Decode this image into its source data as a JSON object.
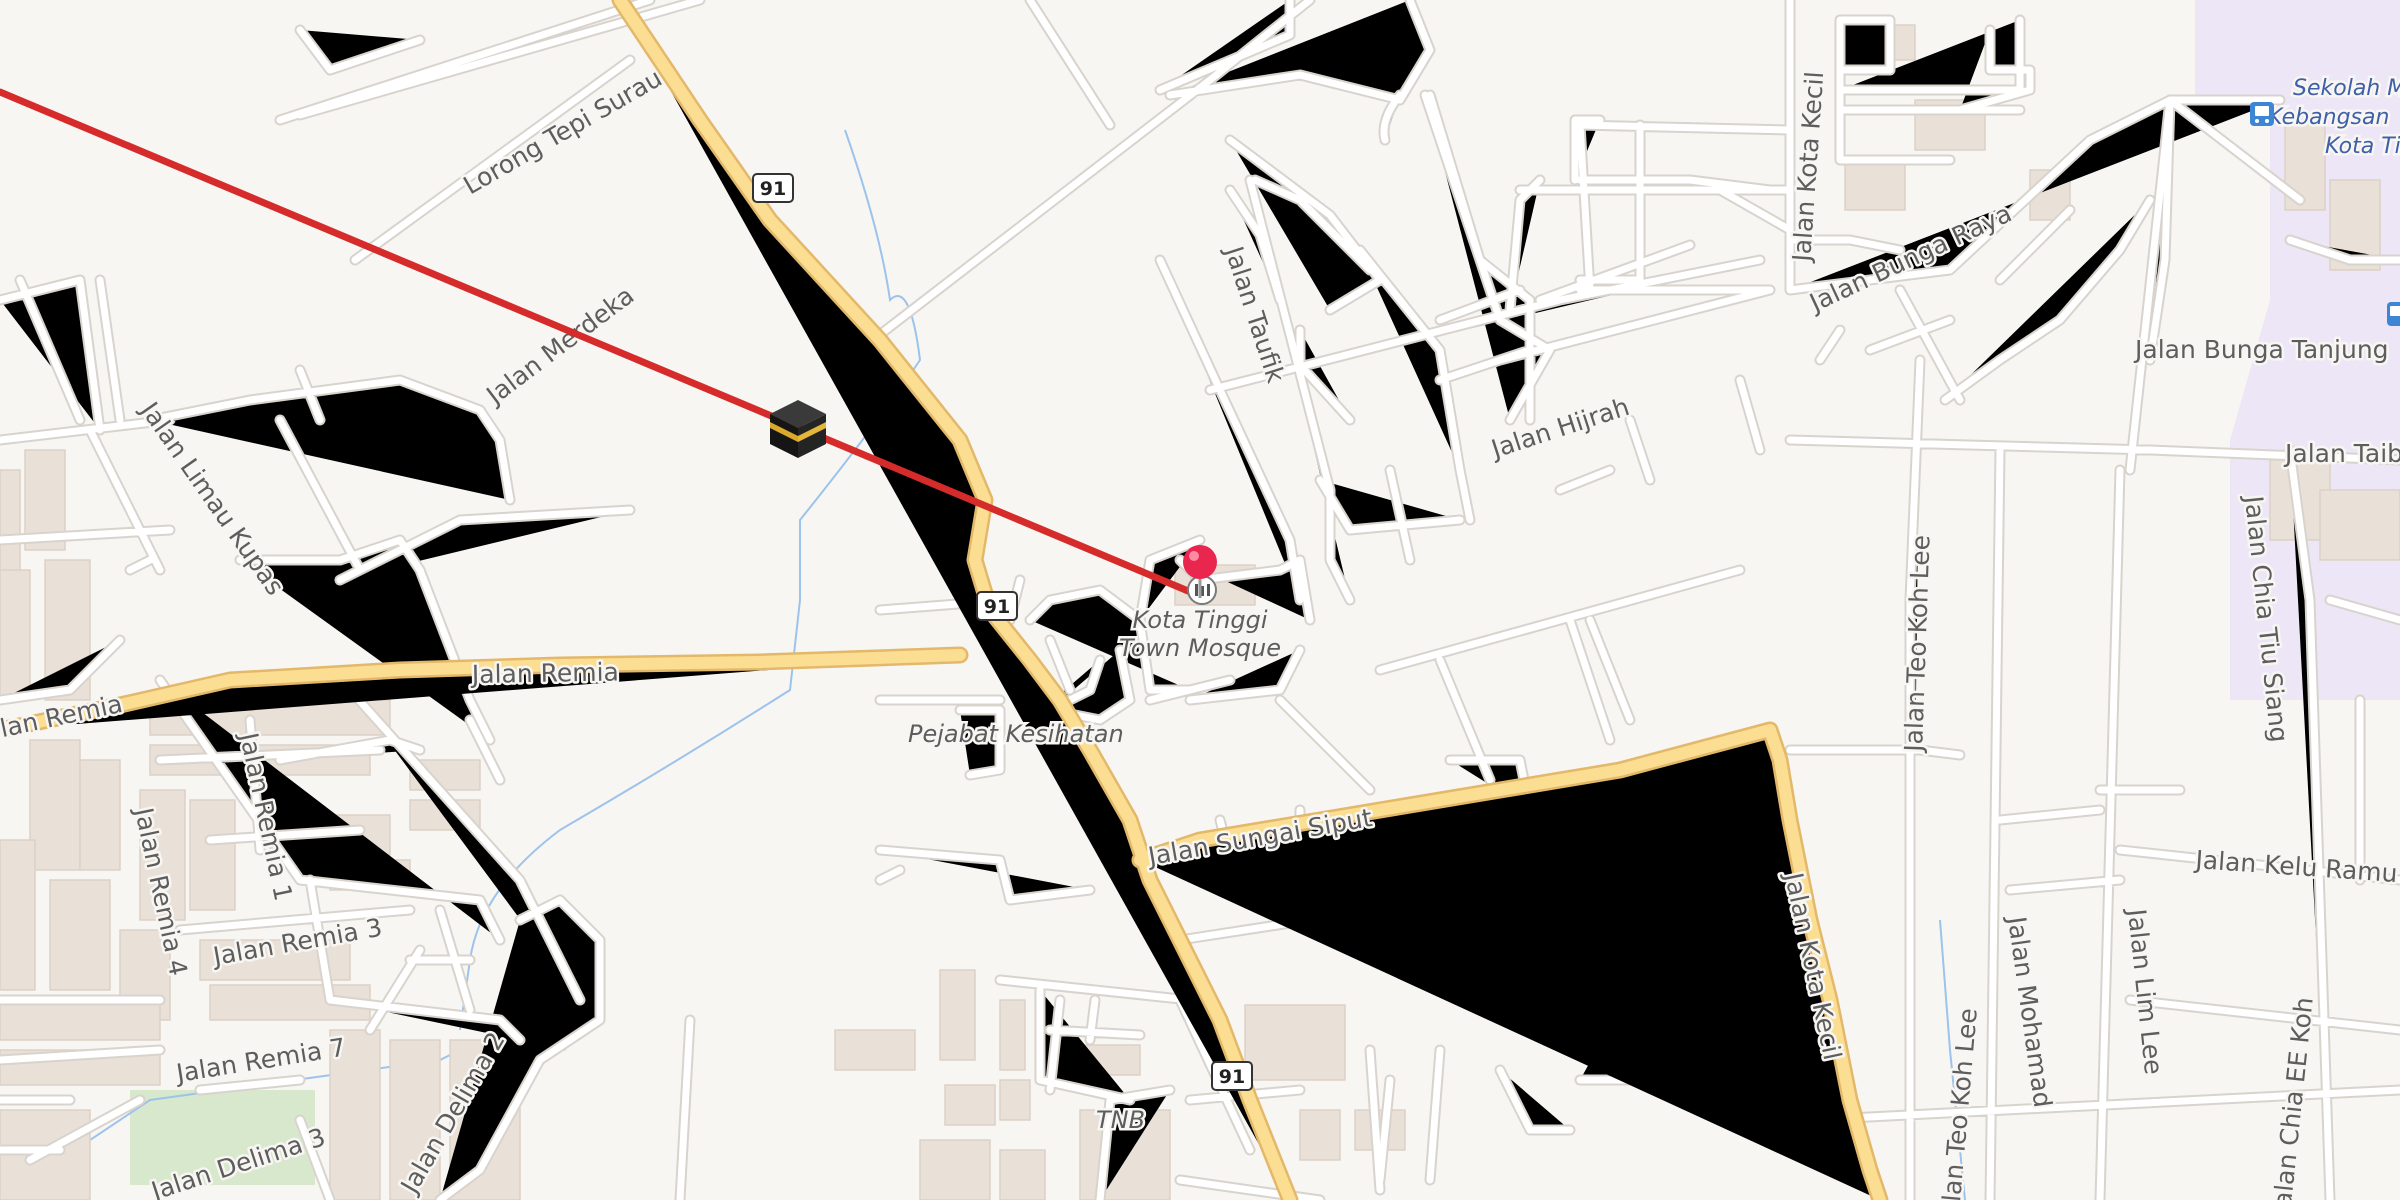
{
  "route_shield": "91",
  "streets": {
    "lorong_tepi_surau": "Lorong Tepi Surau",
    "jalan_merdeka": "Jalan Merdeka",
    "jalan_limau_kupas": "Jalan Limau Kupas",
    "jalan_remia": "Jalan Remia",
    "jalan_remia_left": "Jalan Remia",
    "jalan_remia_1": "Jalan Remia 1",
    "jalan_remia_3": "Jalan Remia 3",
    "jalan_remia_4": "Jalan Remia 4",
    "jalan_remia_7": "Jalan Remia 7",
    "jalan_delima_3": "Jalan Delima 3",
    "jalan_delima_2": "Jalan Delima 2",
    "jalan_taufik": "Jalan Taufik",
    "jalan_hijrah": "Jalan Hijrah",
    "jalan_sungai_siput": "Jalan Sungai Siput",
    "jalan_kota_kecil_top": "Jalan Kota Kecil",
    "jalan_kota_kecil_bottom": "Jalan Kota Kecil",
    "jalan_bunga_raya": "Jalan Bunga Raya",
    "jalan_bunga_tanjung": "Jalan Bunga Tanjung",
    "jalan_taib": "Jalan Taib",
    "jalan_chia_tiu_siang": "Jalan Chia Tiu Siang",
    "jalan_teo_koh_lee": "Jalan Teo Koh Lee",
    "jalan_teo_koh_lee_2": "Jalan Teo Koh Lee",
    "jalan_kelu_ramu": "Jalan Kelu Ramu",
    "jalan_mohamad": "Jalan Mohamad",
    "jalan_lim_lee": "Jalan Lim Lee",
    "jalan_chia_ee_koh": "Jalan Chia EE Koh"
  },
  "places": {
    "mosque_line1": "Kota Tinggi",
    "mosque_line2": "Town Mosque",
    "pejabat_kesihatan": "Pejabat Kesihatan",
    "tnb": "TNB",
    "school_line1": "Sekolah Me",
    "school_line2": "Kebangsan",
    "school_line3": "Kota Tin"
  },
  "icons": {
    "qibla_marker": "kaaba-icon",
    "pin": "map-pin-icon",
    "bus": "bus-stop-icon"
  },
  "colors": {
    "qibla_line": "#d52b2b",
    "pin": "#e8264e",
    "major_road": "#fbde92",
    "school_area": "#ede6f6"
  }
}
